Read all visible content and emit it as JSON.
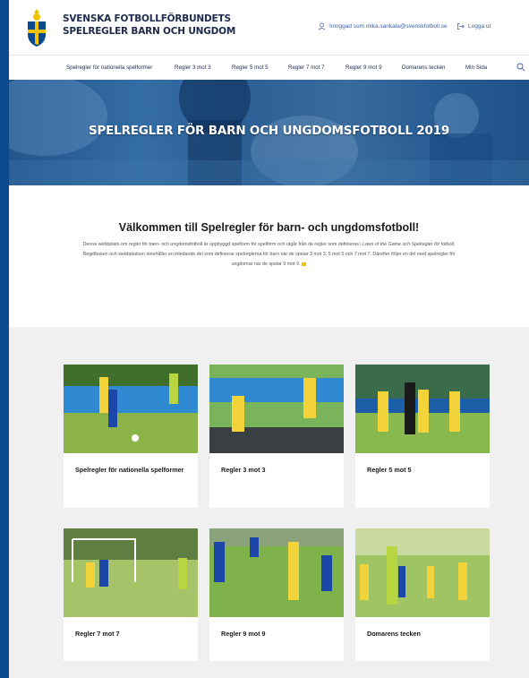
{
  "header": {
    "brand_line1": "SVENSKA FOTBOLLFÖRBUNDETS",
    "brand_line2": "SPELREGLER BARN OCH UNGDOM",
    "user_text": "Inloggad som mika.sankala@svenskfotboll.se",
    "logout_label": "Logga ut"
  },
  "nav": {
    "items": [
      "Spelregler för nationella spelformer",
      "Regler 3 mot 3",
      "Regler 5 mot 5",
      "Regler 7 mot 7",
      "Regler 9 mot 9",
      "Domarens tecken",
      "Min Sida"
    ]
  },
  "hero": {
    "title": "SPELREGLER FÖR BARN OCH UNGDOMSFOTBOLL 2019"
  },
  "welcome": {
    "title": "Välkommen till Spelregler för barn- och ungdomsfotboll!",
    "text_1": "Denna webbplats om regler för barn- och ungdomsfotboll är uppbyggd spelform för spelform och utgår från de regler som definieras i ",
    "text_italic": "Laws of the Game och Spelregler för fotboll.",
    "text_2": " Regelboken och webbplatsen innehåller en inledande del som definierar spelreglerna för barn när de spelar 3 mot 3, 5 mot 5 och 7 mot 7. Därefter följer en del med spelregler för ungdomar när de spelar 9 mot 9."
  },
  "cards": [
    {
      "label": "Spelregler för nationella spelformer"
    },
    {
      "label": "Regler 3 mot 3"
    },
    {
      "label": "Regler 5 mot 5"
    },
    {
      "label": "Regler 7 mot 7"
    },
    {
      "label": "Regler 9 mot 9"
    },
    {
      "label": "Domarens tecken"
    }
  ],
  "colors": {
    "frame_blue": "#0b4a8f",
    "accent_yellow": "#f4c300",
    "text_dark": "#1d2a4a",
    "link_blue": "#3b5ca8"
  },
  "icons": [
    "logo-shield",
    "user-icon",
    "logout-icon",
    "search-icon"
  ]
}
